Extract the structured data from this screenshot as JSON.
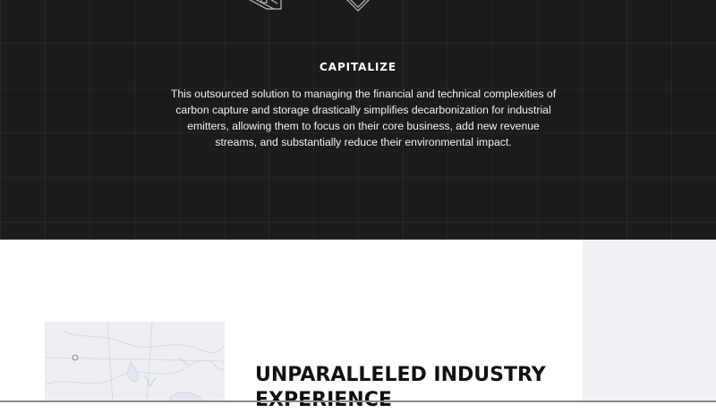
{
  "capitalize_section": {
    "title": "CAPITALIZE",
    "body": "This outsourced solution to managing the financial and technical complexities of carbon capture and storage drastically simplifies decarbonization for industrial emitters, allowing them to focus on their core business, add new revenue streams, and substantially reduce their environmental impact."
  },
  "experience_section": {
    "heading": "UNPARALLELED INDUSTRY EXPERIENCE"
  },
  "colors": {
    "dark_background": "#1c1a1b",
    "light_panel": "#f0f1f5",
    "heading_text": "#111111"
  },
  "icons": {
    "illustration": "keyboard-and-device-line-art",
    "map": "region-map-with-location-pin"
  }
}
